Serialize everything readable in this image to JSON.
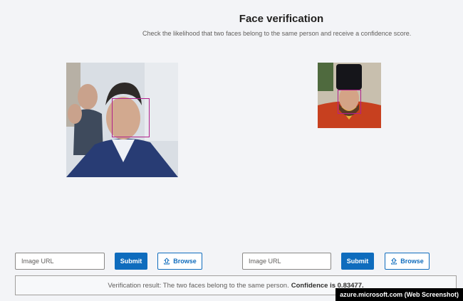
{
  "header": {
    "title": "Face verification",
    "subtitle": "Check the likelihood that two faces belong to the same person and receive a confidence score."
  },
  "left": {
    "photo_alt": "Photo of a man in a blue suit with a detected face box",
    "input_placeholder": "Image URL",
    "submit_label": "Submit",
    "browse_label": "Browse"
  },
  "right": {
    "photo_alt": "Photo of a man in red vestments and black hat with a detected face box",
    "input_placeholder": "Image URL",
    "submit_label": "Submit",
    "browse_label": "Browse"
  },
  "result": {
    "text": "Verification result: The two faces belong to the same person.",
    "confidence": "Confidence is 0.83477."
  },
  "watermark": "azure.microsoft.com (Web Screenshot)",
  "colors": {
    "accent": "#0f6cbd",
    "face_box": "#b0208c"
  }
}
